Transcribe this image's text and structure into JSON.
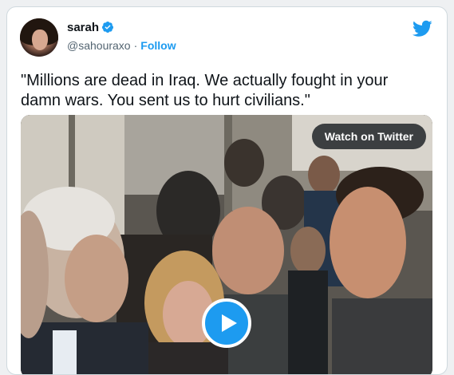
{
  "author": {
    "display_name": "sarah",
    "handle": "@sahouraxo",
    "separator": "·",
    "follow_label": "Follow",
    "verified": true
  },
  "brand": {
    "icon": "twitter-bird-icon",
    "color": "#1d9bf0"
  },
  "tweet": {
    "text": "\"Millions are dead in Iraq. We actually fought in your damn wars. You sent us to hurt civilians.\""
  },
  "media": {
    "type": "video",
    "watch_label": "Watch on Twitter",
    "play_icon": "play-icon"
  },
  "colors": {
    "accent": "#1d9bf0",
    "text": "#0f1419",
    "muted": "#536471"
  }
}
